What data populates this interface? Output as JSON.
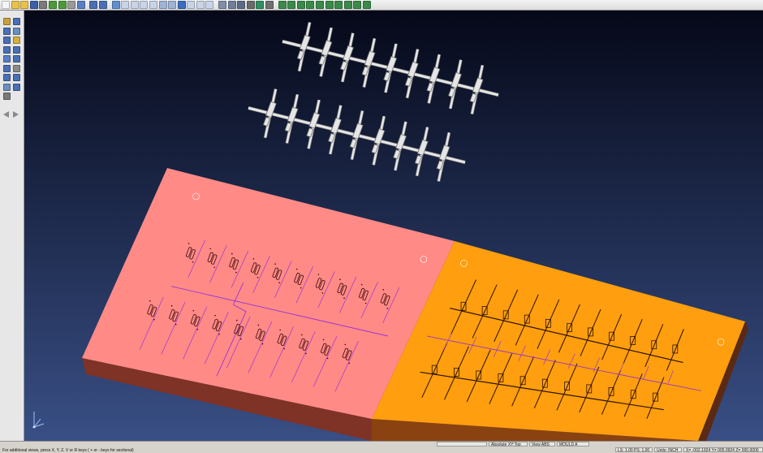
{
  "toolbar": {
    "buttons": [
      {
        "icon": "new-file-icon",
        "color": "#f5f5f5"
      },
      {
        "icon": "open-folder-icon",
        "color": "#e8c24a"
      },
      {
        "icon": "open-file-icon",
        "color": "#e8c24a"
      },
      {
        "icon": "save-icon",
        "color": "#3c5fa8"
      },
      {
        "icon": "print-icon",
        "color": "#7a7a7a"
      },
      {
        "icon": "import-icon",
        "color": "#4e9a3a"
      },
      {
        "icon": "export-icon",
        "color": "#4e9a3a"
      },
      {
        "icon": "cut-icon",
        "color": "#9a9a9a"
      },
      {
        "icon": "window-icon",
        "color": "#5a7ec4"
      },
      {
        "icon": "undo-icon",
        "color": "#4a6fb5"
      },
      {
        "icon": "redo-icon",
        "color": "#4a6fb5"
      },
      {
        "icon": "refresh-icon",
        "color": "#5f8fd0"
      },
      {
        "icon": "document-icon",
        "color": "#c8d4e8"
      },
      {
        "icon": "document-icon",
        "color": "#c8d4e8"
      },
      {
        "icon": "document-icon",
        "color": "#c8d4e8"
      },
      {
        "icon": "document-icon",
        "color": "#c8d4e8"
      },
      {
        "icon": "layer-icon",
        "color": "#9fb3d6"
      },
      {
        "icon": "layer-icon",
        "color": "#9fb3d6"
      },
      {
        "icon": "info-icon",
        "color": "#3a6fc0"
      },
      {
        "icon": "document-icon",
        "color": "#c8d4e8"
      },
      {
        "icon": "document-icon",
        "color": "#c8d4e8"
      },
      {
        "icon": "document-icon",
        "color": "#c8d4e8"
      },
      {
        "icon": "tool-icon",
        "color": "#7f8fa8"
      },
      {
        "icon": "shaded-view-icon",
        "color": "#6f7f99"
      },
      {
        "icon": "wireframe-icon",
        "color": "#5b6b85"
      },
      {
        "icon": "render-icon",
        "color": "#6a6a6a"
      },
      {
        "icon": "color-icon",
        "color": "#2f8f5f"
      },
      {
        "icon": "gear-icon",
        "color": "#707070"
      },
      {
        "icon": "view-top-icon",
        "color": "#3a8a4a"
      },
      {
        "icon": "view-front-icon",
        "color": "#3a8a4a"
      },
      {
        "icon": "view-side-icon",
        "color": "#3a8a4a"
      },
      {
        "icon": "view-iso-icon",
        "color": "#3a8a4a"
      },
      {
        "icon": "rotate-icon",
        "color": "#3a8a4a"
      },
      {
        "icon": "pan-icon",
        "color": "#3a8a4a"
      },
      {
        "icon": "zoom-icon",
        "color": "#3a8a4a"
      },
      {
        "icon": "zoom-fit-icon",
        "color": "#3a8a4a"
      },
      {
        "icon": "zoom-window-icon",
        "color": "#3a8a4a"
      },
      {
        "icon": "section-icon",
        "color": "#3a8a4a"
      }
    ]
  },
  "left_toolbar": {
    "buttons": [
      {
        "icon": "select-icon",
        "color": "#c8a040"
      },
      {
        "icon": "line-icon",
        "color": "#4a6fb5"
      },
      {
        "icon": "dimension-icon",
        "color": "#4a6fb5"
      },
      {
        "icon": "edit-icon",
        "color": "#6a8fc0"
      },
      {
        "icon": "arc-icon",
        "color": "#4a6fb5"
      },
      {
        "icon": "box-icon",
        "color": "#d4b040"
      },
      {
        "icon": "curve-icon",
        "color": "#4a6fb5"
      },
      {
        "icon": "surface-icon",
        "color": "#4a6fb5"
      },
      {
        "icon": "solid-icon",
        "color": "#5a7ec4"
      },
      {
        "icon": "transform-icon",
        "color": "#4a6fb5"
      },
      {
        "icon": "measure-icon",
        "color": "#4a6fb5"
      },
      {
        "icon": "layer-icon",
        "color": "#8a8a8a"
      },
      {
        "icon": "group-icon",
        "color": "#4a6fb5"
      },
      {
        "icon": "text-icon",
        "color": "#4a6fb5"
      },
      {
        "icon": "analyze-icon",
        "color": "#6a8fc0"
      },
      {
        "icon": "drawing-icon",
        "color": "#4a6fb5"
      },
      {
        "icon": "picture-icon",
        "color": "#7a7a7a"
      }
    ],
    "arrows": [
      "arrow-left-icon",
      "arrow-right-icon"
    ]
  },
  "scene": {
    "background_top": "#050818",
    "background_bottom": "#394f85",
    "pink_plate_color": "#ff8a86",
    "orange_plate_color": "#ff9e0e",
    "rib_color": "#a7161f",
    "runner_color": "#8a2be2",
    "part_color": "#e5e5e5",
    "axis_icon": "xyz-axis-icon"
  },
  "status": {
    "hint": "For additional views, press X, Y, Z, V or R keys ( + or - keys for sectional)",
    "row1": [
      {
        "name": "status-field-blank",
        "text": ""
      },
      {
        "name": "status-view-orientation",
        "text": "Absolute XY:Top"
      },
      {
        "name": "status-view-mode",
        "text": "View ABS"
      },
      {
        "name": "status-layer",
        "text": "MOULD A"
      }
    ],
    "row2": [
      {
        "name": "status-line-style",
        "text": "LS: 1.00 PS: 1.00"
      },
      {
        "name": "status-units",
        "text": "Units: INCH"
      },
      {
        "name": "status-coordinates",
        "text": "X= -002.1924 Y= 005.0924 Z= 000.0000"
      }
    ]
  }
}
